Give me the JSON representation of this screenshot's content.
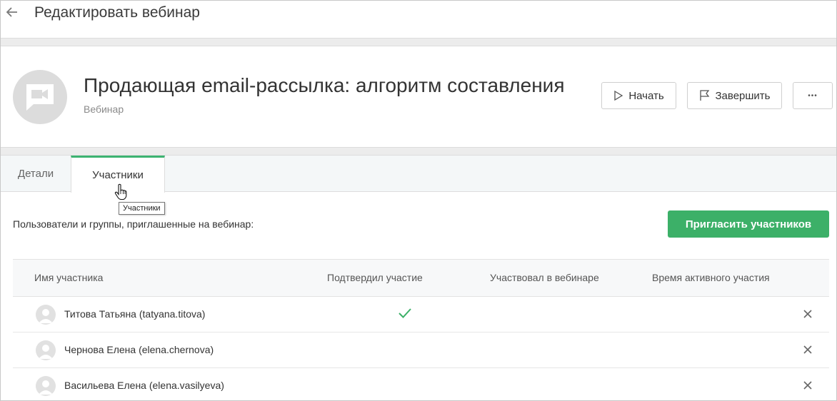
{
  "header": {
    "title": "Редактировать вебинар",
    "back_icon": "arrow-left-icon"
  },
  "webinar": {
    "title": "Продающая email-рассылка: алгоритм составления",
    "type_label": "Вебинар",
    "avatar_icon": "video-chat-icon"
  },
  "actions": {
    "start_label": "Начать",
    "finish_label": "Завершить",
    "more_label": "•••"
  },
  "tabs": [
    {
      "label": "Детали",
      "active": false
    },
    {
      "label": "Участники",
      "active": true
    }
  ],
  "tooltip": "Участники",
  "participants_section": {
    "description": "Пользователи и группы, приглашенные на вебинар:",
    "invite_button": "Пригласить участников",
    "columns": [
      "Имя участника",
      "Подтвердил участие",
      "Участвовал в вебинаре",
      "Время активного участия"
    ],
    "rows": [
      {
        "name": "Титова Татьяна (tatyana.titova)",
        "confirmed": true
      },
      {
        "name": "Чернова Елена (elena.chernova)",
        "confirmed": false
      },
      {
        "name": "Васильева Елена (elena.vasilyeva)",
        "confirmed": false
      }
    ]
  },
  "colors": {
    "accent": "#3cb068",
    "tab_active_border": "#3cb371"
  }
}
